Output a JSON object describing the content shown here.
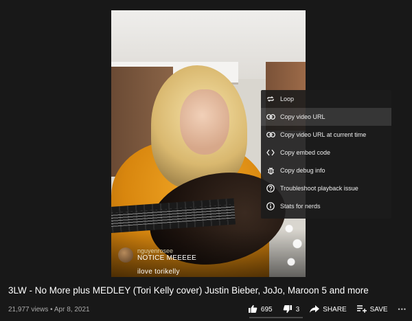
{
  "video": {
    "title": "3LW - No More plus MEDLEY (Tori Kelly cover) Justin Bieber, JoJo, Maroon 5 and more",
    "views_date": "21,977 views • Apr 8, 2021"
  },
  "chat": [
    {
      "user": "nguyenrosee",
      "text": "NOTICE MEEEEE"
    },
    {
      "user": "",
      "text": "ilove torikelly"
    }
  ],
  "context_menu": {
    "items": [
      {
        "icon": "loop-icon",
        "label": "Loop"
      },
      {
        "icon": "link-icon",
        "label": "Copy video URL",
        "highlighted": true
      },
      {
        "icon": "link-icon",
        "label": "Copy video URL at current time"
      },
      {
        "icon": "code-icon",
        "label": "Copy embed code"
      },
      {
        "icon": "bug-icon",
        "label": "Copy debug info"
      },
      {
        "icon": "question-icon",
        "label": "Troubleshoot playback issue"
      },
      {
        "icon": "info-icon",
        "label": "Stats for nerds"
      }
    ]
  },
  "actions": {
    "like_count": "695",
    "dislike_count": "3",
    "share_label": "SHARE",
    "save_label": "SAVE",
    "more_label": "•••"
  },
  "colors": {
    "background": "#181818",
    "menu_bg": "#1c1c1c",
    "text": "#ffffff",
    "meta": "#aaaaaa"
  }
}
